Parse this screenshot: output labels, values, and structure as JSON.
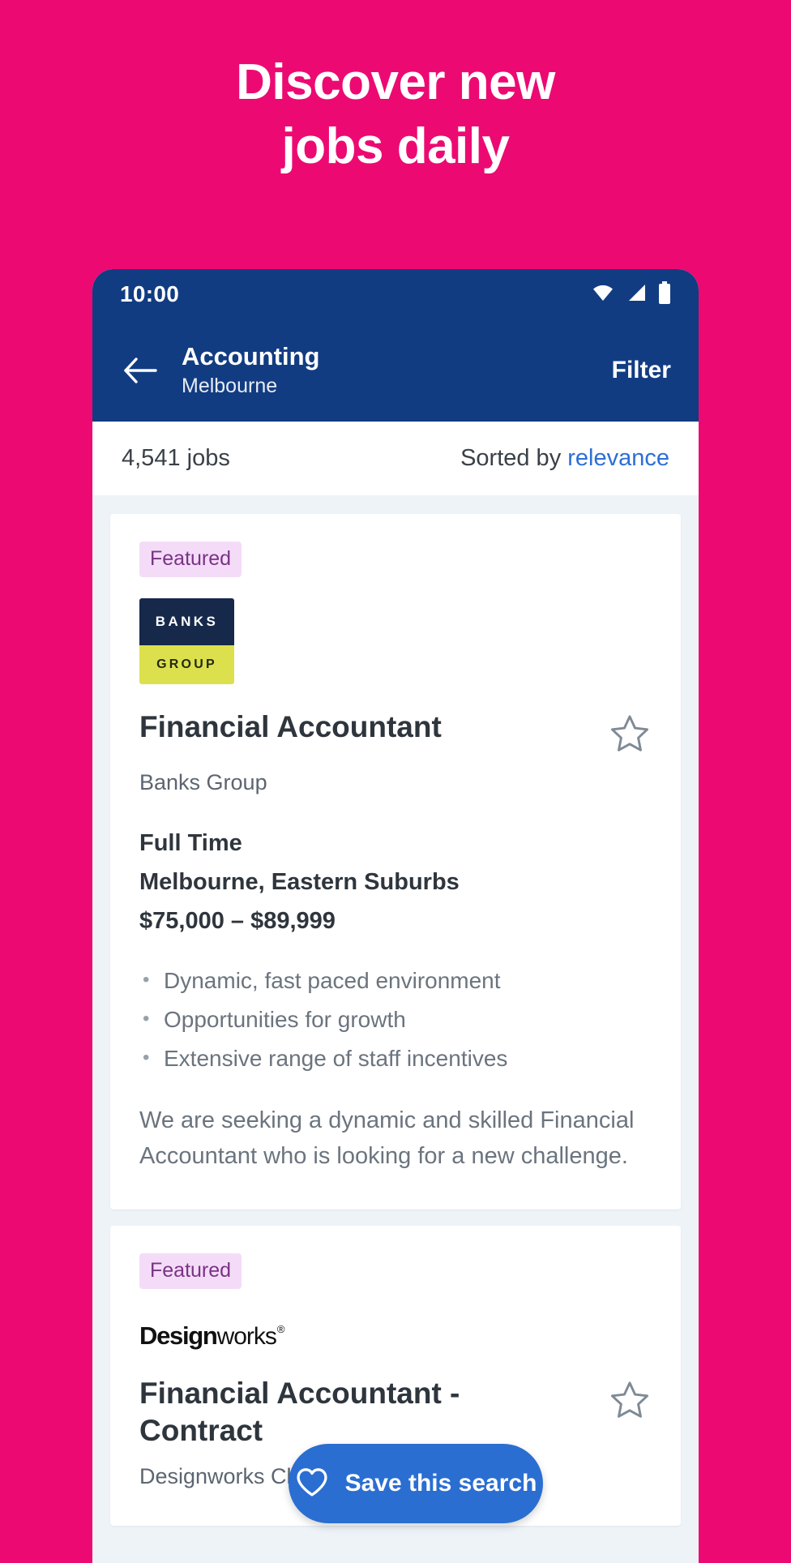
{
  "promo": {
    "line1": "Discover new",
    "line2": "jobs daily"
  },
  "statusbar": {
    "time": "10:00",
    "icons": [
      "wifi-icon",
      "signal-icon",
      "battery-icon"
    ]
  },
  "appbar": {
    "back_icon": "back-arrow-icon",
    "title": "Accounting",
    "subtitle": "Melbourne",
    "action_label": "Filter"
  },
  "results": {
    "count_label": "4,541 jobs",
    "sorted_prefix": "Sorted by ",
    "sorted_value": "relevance",
    "link_color": "#2b6fd6"
  },
  "jobs": [
    {
      "badge": "Featured",
      "logo": {
        "type": "banks-group-logo",
        "top_text": "BANKS",
        "bottom_text": "GROUP",
        "top_color": "#16294a",
        "bottom_color": "#dde04d"
      },
      "title": "Financial Accountant",
      "company": "Banks Group",
      "work_type": "Full Time",
      "location": "Melbourne, Eastern Suburbs",
      "salary": "$75,000 – $89,999",
      "bullets": [
        "Dynamic, fast paced environment",
        "Opportunities for growth",
        "Extensive range of staff incentives"
      ],
      "description": "We are seeking a dynamic and skilled Financial Accountant who is looking for a new challenge.",
      "star_icon": "star-outline-icon"
    },
    {
      "badge": "Featured",
      "logo": {
        "type": "designworks-logo",
        "bold_text": "Design",
        "regular_text": "works",
        "trademark": "®"
      },
      "title": "Financial Accountant - Contract",
      "company": "Designworks Clothing Company Pty Ltd",
      "star_icon": "star-outline-icon"
    }
  ],
  "fab": {
    "icon": "heart-outline-icon",
    "label": "Save this search",
    "color": "#2a6ed2"
  },
  "theme": {
    "background": "#ec0a72",
    "appbar": "#123c82",
    "page": "#eef3f8"
  }
}
